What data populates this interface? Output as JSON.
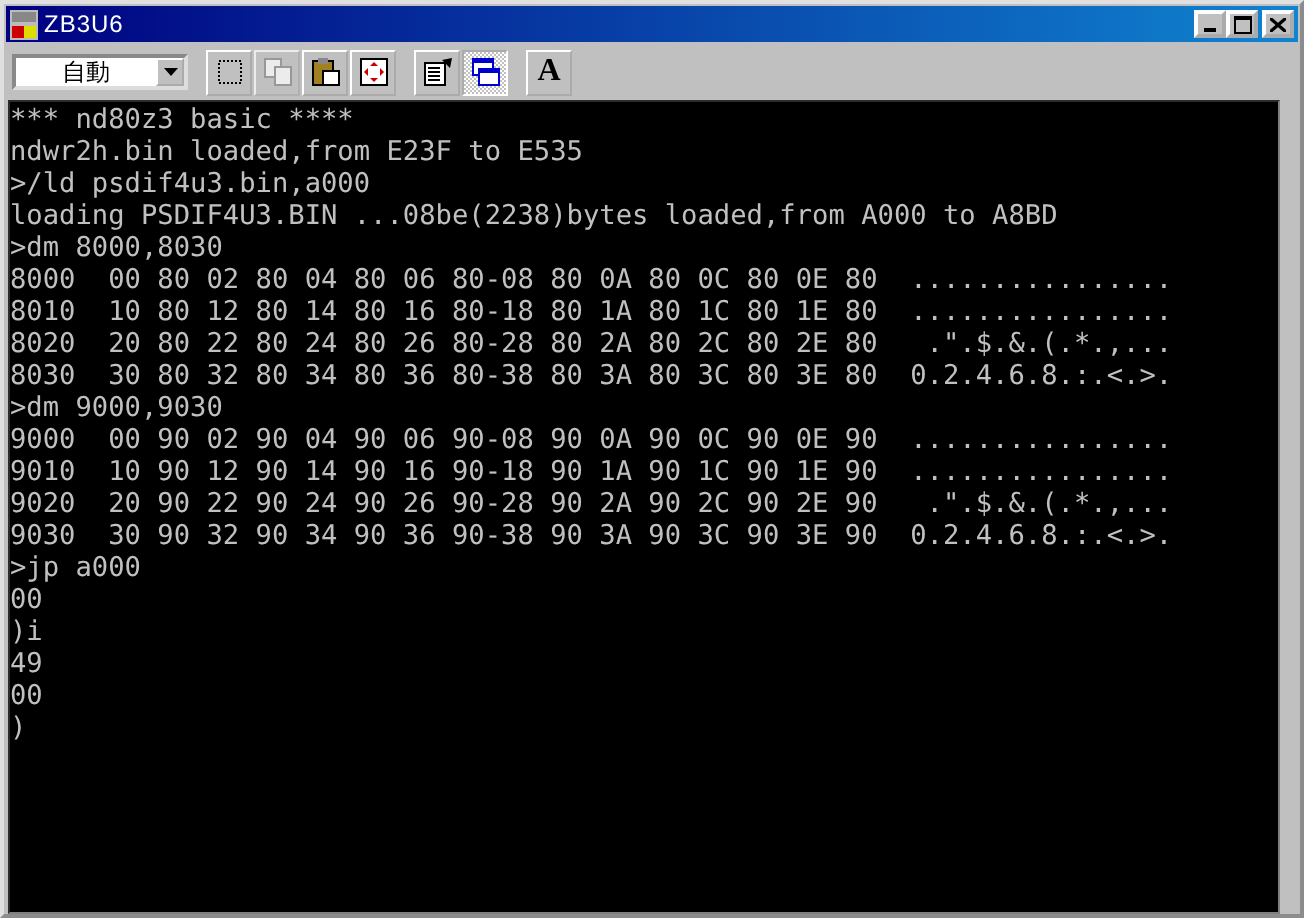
{
  "window": {
    "title": "ZB3U6"
  },
  "toolbar": {
    "font_size": "自動",
    "buttons": [
      {
        "kind": "mark",
        "disabled": false,
        "pressed": false
      },
      {
        "kind": "copy",
        "disabled": true,
        "pressed": false
      },
      {
        "kind": "paste",
        "disabled": false,
        "pressed": false
      },
      {
        "kind": "fullscreen",
        "disabled": false,
        "pressed": false
      },
      {
        "kind": "properties",
        "disabled": false,
        "pressed": false
      },
      {
        "kind": "background",
        "disabled": false,
        "pressed": true
      },
      {
        "kind": "font",
        "label": "A",
        "disabled": false,
        "pressed": false
      }
    ]
  },
  "console": {
    "lines": [
      "*** nd80z3 basic ****",
      "ndwr2h.bin loaded,from E23F to E535",
      ">/ld psdif4u3.bin,a000",
      "loading PSDIF4U3.BIN ...08be(2238)bytes loaded,from A000 to A8BD",
      ">dm 8000,8030",
      "8000  00 80 02 80 04 80 06 80-08 80 0A 80 0C 80 0E 80  ................",
      "8010  10 80 12 80 14 80 16 80-18 80 1A 80 1C 80 1E 80  ................",
      "8020  20 80 22 80 24 80 26 80-28 80 2A 80 2C 80 2E 80   .\".$.&.(.*.,...",
      "8030  30 80 32 80 34 80 36 80-38 80 3A 80 3C 80 3E 80  0.2.4.6.8.:.<.>.",
      ">dm 9000,9030",
      "9000  00 90 02 90 04 90 06 90-08 90 0A 90 0C 90 0E 90  ................",
      "9010  10 90 12 90 14 90 16 90-18 90 1A 90 1C 90 1E 90  ................",
      "9020  20 90 22 90 24 90 26 90-28 90 2A 90 2C 90 2E 90   .\".$.&.(.*.,...",
      "9030  30 90 32 90 34 90 36 90-38 90 3A 90 3C 90 3E 90  0.2.4.6.8.:.<.>.",
      ">jp a000",
      "00",
      ")i",
      "49",
      "00",
      ")"
    ]
  }
}
